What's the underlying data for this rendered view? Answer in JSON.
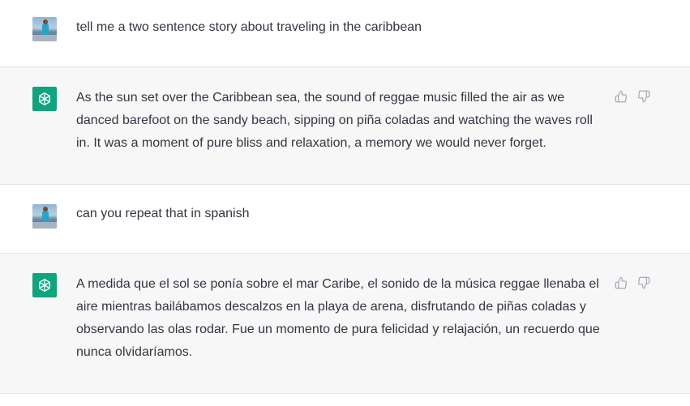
{
  "conversation": [
    {
      "role": "user",
      "text": "tell me a two sentence story about traveling in the caribbean"
    },
    {
      "role": "assistant",
      "text": "As the sun set over the Caribbean sea, the sound of reggae music filled the air as we danced barefoot on the sandy beach, sipping on piña coladas and watching the waves roll in. It was a moment of pure bliss and relaxation, a memory we would never forget."
    },
    {
      "role": "user",
      "text": "can you repeat that in spanish"
    },
    {
      "role": "assistant",
      "text": "A medida que el sol se ponía sobre el mar Caribe, el sonido de la música reggae llenaba el aire mientras bailábamos descalzos en la playa de arena, disfrutando de piñas coladas y observando las olas rodar. Fue un momento de pura felicidad y relajación, un recuerdo que nunca olvidaríamos."
    }
  ],
  "icons": {
    "user_avatar": "user-photo-avatar",
    "assistant_avatar": "openai-logo-icon",
    "thumbs_up": "thumbs-up-icon",
    "thumbs_down": "thumbs-down-icon"
  },
  "colors": {
    "assistant_bg": "#f7f7f8",
    "user_bg": "#ffffff",
    "brand": "#10a37f",
    "text": "#343541",
    "icon": "#acacbe"
  }
}
